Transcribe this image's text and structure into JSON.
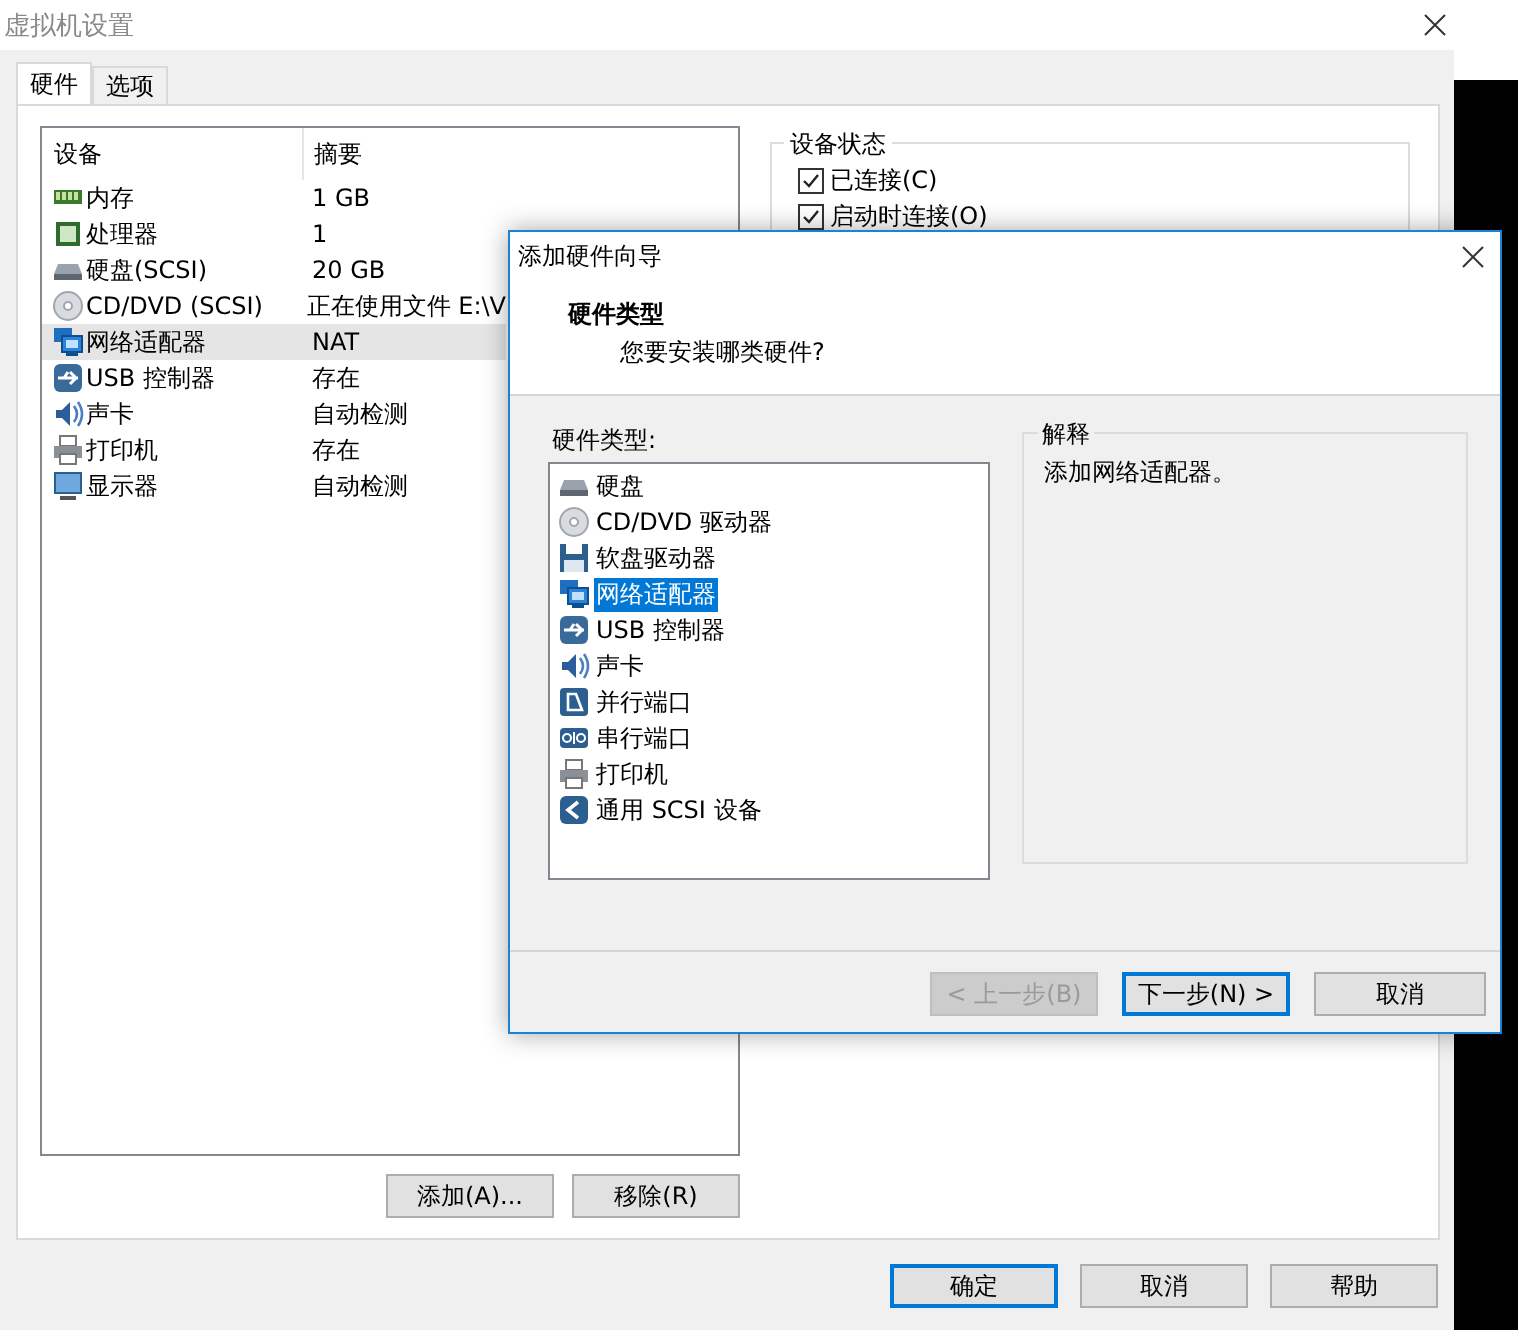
{
  "window": {
    "title": "虚拟机设置"
  },
  "tabs": [
    {
      "label": "硬件",
      "selected": true
    },
    {
      "label": "选项",
      "selected": false
    }
  ],
  "devices": {
    "columns": [
      "设备",
      "摘要"
    ],
    "rows": [
      {
        "kind": "memory",
        "name": "内存",
        "summary": "1 GB",
        "selected": false
      },
      {
        "kind": "cpu",
        "name": "处理器",
        "summary": "1",
        "selected": false
      },
      {
        "kind": "disk",
        "name": "硬盘(SCSI)",
        "summary": "20 GB",
        "selected": false
      },
      {
        "kind": "cdrom",
        "name": "CD/DVD (SCSI)",
        "summary": "正在使用文件 E:\\V",
        "selected": false
      },
      {
        "kind": "network",
        "name": "网络适配器",
        "summary": "NAT",
        "selected": true
      },
      {
        "kind": "usb",
        "name": "USB 控制器",
        "summary": "存在",
        "selected": false
      },
      {
        "kind": "sound",
        "name": "声卡",
        "summary": "自动检测",
        "selected": false
      },
      {
        "kind": "printer",
        "name": "打印机",
        "summary": "存在",
        "selected": false
      },
      {
        "kind": "display",
        "name": "显示器",
        "summary": "自动检测",
        "selected": false
      }
    ]
  },
  "list_buttons": [
    "添加(A)...",
    "移除(R)"
  ],
  "device_status": {
    "title": "设备状态",
    "options": [
      {
        "label": "已连接(C)",
        "checked": true
      },
      {
        "label": "启动时连接(O)",
        "checked": true
      }
    ]
  },
  "footer_buttons": [
    {
      "label": "确定",
      "default": true
    },
    {
      "label": "取消",
      "default": false
    },
    {
      "label": "帮助",
      "default": false
    }
  ],
  "wizard": {
    "title": "添加硬件向导",
    "heading": "硬件类型",
    "subtitle": "您要安装哪类硬件?",
    "list_label": "硬件类型:",
    "items": [
      {
        "kind": "disk",
        "label": "硬盘",
        "selected": false
      },
      {
        "kind": "cdrom",
        "label": "CD/DVD 驱动器",
        "selected": false
      },
      {
        "kind": "floppy",
        "label": "软盘驱动器",
        "selected": false
      },
      {
        "kind": "network",
        "label": "网络适配器",
        "selected": true
      },
      {
        "kind": "usb",
        "label": "USB 控制器",
        "selected": false
      },
      {
        "kind": "sound",
        "label": "声卡",
        "selected": false
      },
      {
        "kind": "parallel",
        "label": "并行端口",
        "selected": false
      },
      {
        "kind": "serial",
        "label": "串行端口",
        "selected": false
      },
      {
        "kind": "printer",
        "label": "打印机",
        "selected": false
      },
      {
        "kind": "scsi",
        "label": "通用 SCSI 设备",
        "selected": false
      }
    ],
    "explanation": {
      "title": "解释",
      "text": "添加网络适配器。"
    },
    "buttons": [
      {
        "label": "< 上一步(B)",
        "disabled": true,
        "default": false
      },
      {
        "label": "下一步(N) >",
        "disabled": false,
        "default": true
      },
      {
        "label": "取消",
        "disabled": false,
        "default": false
      }
    ]
  }
}
